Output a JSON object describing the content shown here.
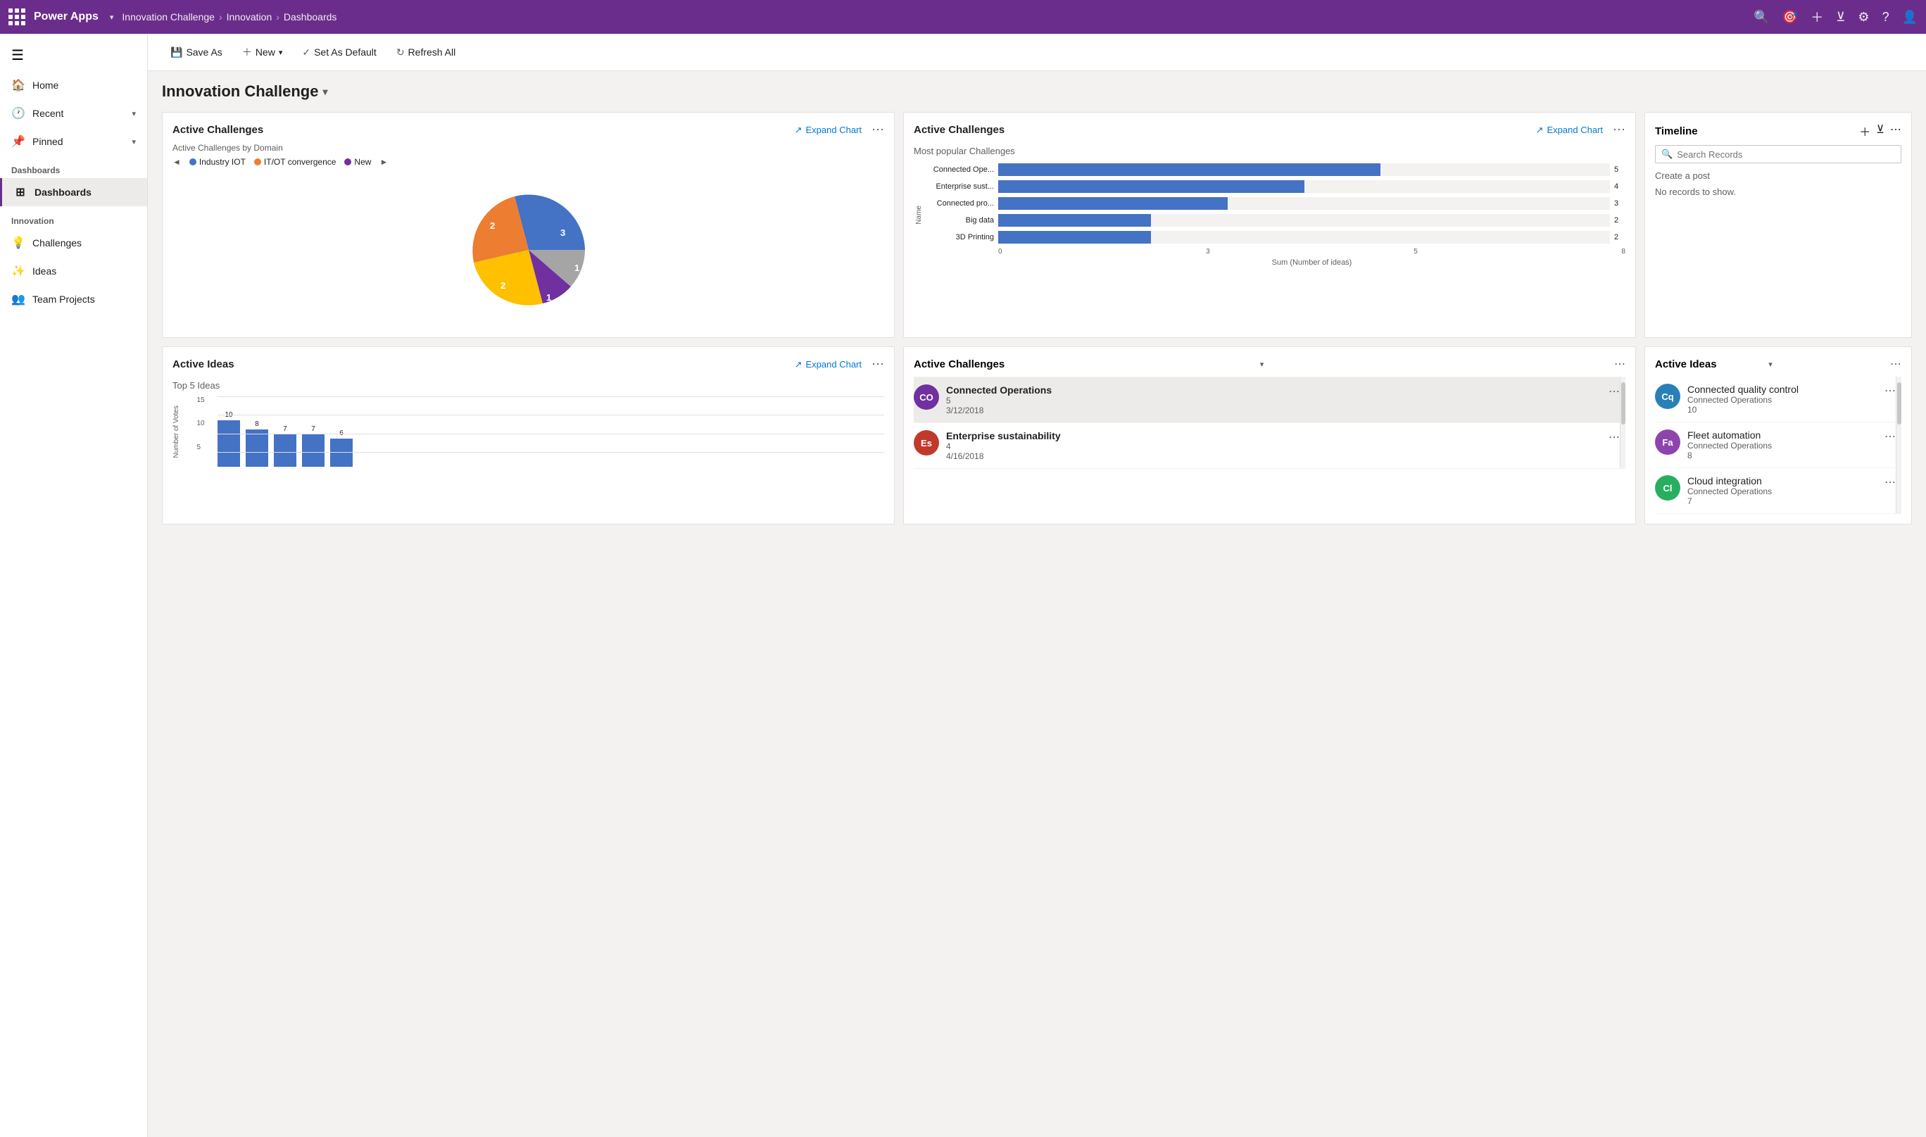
{
  "topnav": {
    "brand": "Power Apps",
    "app": "Innovation Challenge",
    "breadcrumb1": "Innovation",
    "breadcrumb2": "Dashboards"
  },
  "toolbar": {
    "save_as": "Save As",
    "new": "New",
    "set_default": "Set As Default",
    "refresh": "Refresh All"
  },
  "dashboard": {
    "title": "Innovation Challenge"
  },
  "sidebar": {
    "toggle_label": "☰",
    "items": [
      {
        "id": "home",
        "label": "Home",
        "icon": "🏠"
      },
      {
        "id": "recent",
        "label": "Recent",
        "icon": "🕐",
        "chevron": "▾"
      },
      {
        "id": "pinned",
        "label": "Pinned",
        "icon": "📌",
        "chevron": "▾"
      },
      {
        "id": "dashboards-section",
        "label": "Dashboards",
        "section": true
      },
      {
        "id": "dashboards",
        "label": "Dashboards",
        "icon": "⊞",
        "active": true
      },
      {
        "id": "innovation-section",
        "label": "Innovation",
        "section": true
      },
      {
        "id": "challenges",
        "label": "Challenges",
        "icon": "💡"
      },
      {
        "id": "ideas",
        "label": "Ideas",
        "icon": "✨"
      },
      {
        "id": "team-projects",
        "label": "Team Projects",
        "icon": "👥"
      }
    ]
  },
  "chart1": {
    "title": "Active Challenges",
    "expand": "Expand Chart",
    "subtitle": "Active Challenges by Domain",
    "legend": [
      {
        "label": "Industry IOT",
        "color": "#4472c4"
      },
      {
        "label": "IT/OT convergence",
        "color": "#ed7d31"
      },
      {
        "label": "New",
        "color": "#7030a0"
      }
    ],
    "slices": [
      {
        "label": "3",
        "value": 3,
        "color": "#4472c4"
      },
      {
        "label": "2",
        "value": 2,
        "color": "#ed7d31"
      },
      {
        "label": "2",
        "value": 2,
        "color": "#ffc000"
      },
      {
        "label": "1",
        "value": 1,
        "color": "#7030a0"
      },
      {
        "label": "1",
        "value": 1,
        "color": "#e0e0e0"
      }
    ]
  },
  "chart2": {
    "title": "Active Challenges",
    "expand": "Expand Chart",
    "subtitle": "Most popular Challenges",
    "bars": [
      {
        "name": "Connected Ope...",
        "value": 5,
        "max": 8
      },
      {
        "name": "Enterprise sust...",
        "value": 4,
        "max": 8
      },
      {
        "name": "Connected pro...",
        "value": 3,
        "max": 8
      },
      {
        "name": "Big data",
        "value": 2,
        "max": 8
      },
      {
        "name": "3D Printing",
        "value": 2,
        "max": 8
      }
    ],
    "axis_ticks": [
      "0",
      "3",
      "5",
      "8"
    ],
    "axis_label": "Sum (Number of ideas)",
    "y_label": "Name"
  },
  "timeline": {
    "title": "Timeline",
    "search_placeholder": "Search Records",
    "create_post": "Create a post",
    "empty": "No records to show."
  },
  "chart3": {
    "title": "Active Ideas",
    "expand": "Expand Chart",
    "subtitle": "Top 5 Ideas",
    "bars": [
      {
        "name": "",
        "value": 10,
        "label": "10"
      },
      {
        "name": "",
        "value": 8,
        "label": "8"
      },
      {
        "name": "",
        "value": 7,
        "label": "7"
      },
      {
        "name": "",
        "value": 7,
        "label": "7"
      },
      {
        "name": "",
        "value": 6,
        "label": "6"
      }
    ],
    "y_label": "Number of Votes",
    "yticks": [
      "15",
      "10",
      "5"
    ]
  },
  "challenges_list": {
    "title": "Active Challenges",
    "items": [
      {
        "id": "co",
        "initials": "CO",
        "color": "#7030a0",
        "name": "Connected Operations",
        "count": "5",
        "date": "3/12/2018",
        "selected": true
      },
      {
        "id": "es",
        "initials": "Es",
        "color": "#c0392b",
        "name": "Enterprise sustainability",
        "count": "4",
        "date": "4/16/2018",
        "selected": false
      }
    ]
  },
  "ideas_list": {
    "title": "Active Ideas",
    "items": [
      {
        "id": "cq",
        "initials": "Cq",
        "color": "#2980b9",
        "title": "Connected quality control",
        "sub": "Connected Operations",
        "num": "10"
      },
      {
        "id": "fa",
        "initials": "Fa",
        "color": "#8e44ad",
        "title": "Fleet automation",
        "sub": "Connected Operations",
        "num": "8"
      },
      {
        "id": "cl",
        "initials": "Cl",
        "color": "#27ae60",
        "title": "Cloud integration",
        "sub": "Connected Operations",
        "num": "7"
      }
    ]
  }
}
